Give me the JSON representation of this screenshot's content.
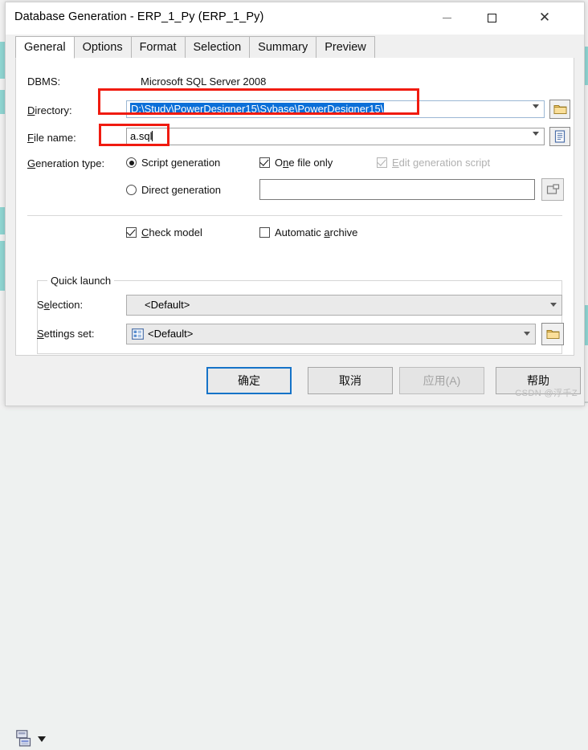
{
  "window": {
    "title": "Database Generation - ERP_1_Py (ERP_1_Py)",
    "minimize_label": "Minimize",
    "maximize_label": "Maximize",
    "close_label": "Close"
  },
  "tabs": [
    {
      "label": "General",
      "active": true
    },
    {
      "label": "Options",
      "active": false
    },
    {
      "label": "Format",
      "active": false
    },
    {
      "label": "Selection",
      "active": false
    },
    {
      "label": "Summary",
      "active": false
    },
    {
      "label": "Preview",
      "active": false
    }
  ],
  "general": {
    "dbms_label": "DBMS:",
    "dbms_value": "Microsoft SQL Server 2008",
    "directory_label_pre": "D",
    "directory_label_accel": "i",
    "directory_label_post": "rectory:",
    "directory_label": "Directory:",
    "directory_value": "D:\\Study\\PowerDesigner15\\Sybase\\PowerDesigner15\\",
    "directory_browse_icon": "folder-icon",
    "filename_label": "File name:",
    "filename_value": "a.sql",
    "filename_browse_icon": "document-icon",
    "generation_type_label": "Generation type:",
    "script_generation_label": "Script generation",
    "script_generation_selected": true,
    "direct_generation_label": "Direct generation",
    "direct_generation_selected": false,
    "one_file_only_label": "One file only",
    "one_file_only_checked": true,
    "edit_generation_script_label": "Edit generation script",
    "edit_generation_script_checked": true,
    "edit_generation_script_disabled": true,
    "direct_connection_value": "",
    "direct_connection_icon": "database-connect-icon",
    "check_model_label": "Check model",
    "check_model_checked": true,
    "automatic_archive_label": "Automatic archive",
    "automatic_archive_checked": false
  },
  "quick_launch": {
    "group_title": "Quick launch",
    "selection_label": "Selection:",
    "selection_value": "<Default>",
    "settings_set_label": "Settings set:",
    "settings_set_value": "<Default>",
    "settings_set_icon": "settings-list-icon",
    "settings_set_browse_icon": "folder-icon"
  },
  "buttons": {
    "stack_icon": "save-stack-icon",
    "dropdown_icon": "chevron-down-icon",
    "ok": "确定",
    "cancel": "取消",
    "apply": "应用(A)",
    "help": "帮助"
  },
  "annotations": {
    "directory_highlight": "red-box-directory",
    "filename_highlight": "red-box-filename",
    "color": "#f01b10"
  },
  "watermark": "CSDN @浮千Z"
}
